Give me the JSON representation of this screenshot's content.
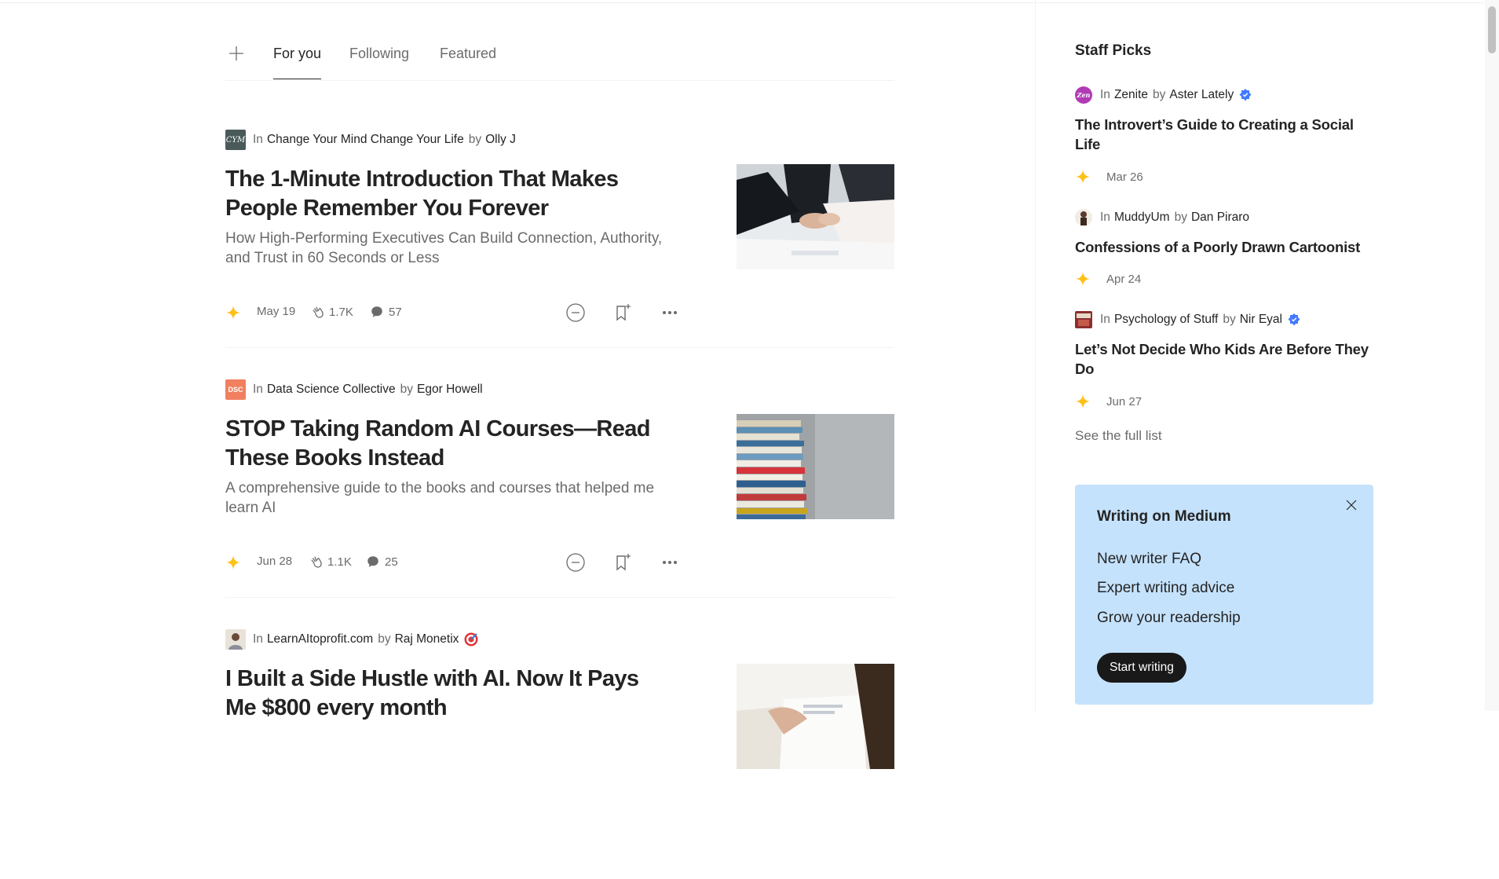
{
  "feed": {
    "tabs": [
      {
        "label": "For you",
        "active": true
      },
      {
        "label": "Following",
        "active": false
      },
      {
        "label": "Featured",
        "active": false
      }
    ],
    "articles": [
      {
        "in": "In",
        "by": "by",
        "publication": "Change Your Mind Change Your Life",
        "pub_logo_text": "CYM",
        "author": "Olly J",
        "title": "The 1-Minute Introduction That Makes People Remember You Forever",
        "subtitle": "How High-Performing Executives Can Build Connection, Authority, and Trust in 60 Seconds or Less",
        "date": "May 19",
        "claps": "1.7K",
        "responses": "57",
        "image": "handshake"
      },
      {
        "in": "In",
        "by": "by",
        "publication": "Data Science Collective",
        "pub_logo_text": "DSC",
        "author": "Egor Howell",
        "title": "STOP Taking Random AI Courses—Read These Books Instead",
        "subtitle": "A comprehensive guide to the books and courses that helped me learn AI",
        "date": "Jun 28",
        "claps": "1.1K",
        "responses": "25",
        "image": "book-stack"
      },
      {
        "in": "In",
        "by": "by",
        "publication": "LearnAItoprofit.com",
        "author": "Raj Monetix",
        "title": "I Built a Side Hustle with AI. Now It Pays Me $800 every month",
        "image": "document-hand"
      }
    ]
  },
  "sidebar": {
    "heading": "Staff Picks",
    "picks": [
      {
        "in": "In",
        "by": "by",
        "publication": "Zenite",
        "avatar_text": "Zen",
        "author": "Aster Lately",
        "verified": true,
        "title": "The Introvert’s Guide to Creating a Social Life",
        "date": "Mar 26"
      },
      {
        "in": "In",
        "by": "by",
        "publication": "MuddyUm",
        "author": "Dan Piraro",
        "verified": false,
        "title": "Confessions of a Poorly Drawn Cartoonist",
        "date": "Apr 24"
      },
      {
        "in": "In",
        "by": "by",
        "publication": "Psychology of Stuff",
        "author": "Nir Eyal",
        "verified": true,
        "title": "Let’s Not Decide Who Kids Are Before They Do",
        "date": "Jun 27"
      }
    ],
    "see_full_list": "See the full list",
    "promo": {
      "title": "Writing on Medium",
      "links": [
        "New writer FAQ",
        "Expert writing advice",
        "Grow your readership"
      ],
      "button": "Start writing"
    }
  },
  "colors": {
    "accent_star": "#FFC017",
    "verified": "#437AFF",
    "promo_bg": "#C5E2FC",
    "text": "#242424",
    "muted": "#6B6B6B"
  }
}
